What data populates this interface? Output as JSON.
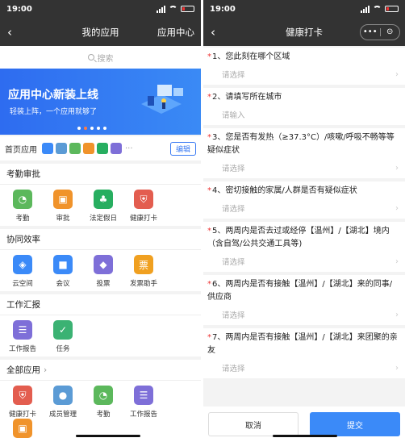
{
  "left": {
    "status_time": "19:00",
    "nav_title": "我的应用",
    "nav_right": "应用中心",
    "search_placeholder": "搜索",
    "banner": {
      "title": "应用中心新装上线",
      "subtitle": "轻装上阵，一个应用就够了"
    },
    "quick_label": "首页应用",
    "quick_more": "···",
    "edit_label": "编辑",
    "sections": [
      {
        "title": "考勤审批",
        "apps": [
          {
            "label": "考勤",
            "icon": "clock-icon",
            "color": "#5cb85c"
          },
          {
            "label": "审批",
            "icon": "stamp-icon",
            "color": "#f0932b"
          },
          {
            "label": "法定假日",
            "icon": "palm-tree-icon",
            "color": "#27ae60"
          },
          {
            "label": "健康打卡",
            "icon": "shield-icon",
            "color": "#e35d4f"
          }
        ]
      },
      {
        "title": "协同效率",
        "apps": [
          {
            "label": "云空间",
            "icon": "cube-icon",
            "color": "#3b8af8"
          },
          {
            "label": "会议",
            "icon": "video-icon",
            "color": "#3b8af8"
          },
          {
            "label": "投票",
            "icon": "vote-icon",
            "color": "#7e6fd8"
          },
          {
            "label": "发票助手",
            "icon": "invoice-icon",
            "color": "#f0a020"
          }
        ]
      },
      {
        "title": "工作汇报",
        "apps": [
          {
            "label": "工作报告",
            "icon": "report-icon",
            "color": "#7e6fd8"
          },
          {
            "label": "任务",
            "icon": "task-check-icon",
            "color": "#3bb273"
          }
        ]
      },
      {
        "title": "全部应用",
        "has_arrow": true,
        "apps": [
          {
            "label": "健康打卡",
            "icon": "shield-icon",
            "color": "#e35d4f"
          },
          {
            "label": "成员管理",
            "icon": "member-icon",
            "color": "#5b9bd5"
          },
          {
            "label": "考勤",
            "icon": "clock-icon",
            "color": "#5cb85c"
          },
          {
            "label": "工作报告",
            "icon": "report-icon",
            "color": "#7e6fd8"
          },
          {
            "label": "审批",
            "icon": "stamp-icon",
            "color": "#f0932b"
          }
        ]
      }
    ],
    "quick_icon_colors": [
      "#3b8af8",
      "#5b9bd5",
      "#5cb85c",
      "#f0932b",
      "#27ae60",
      "#7e6fd8"
    ]
  },
  "right": {
    "status_time": "19:00",
    "nav_title": "健康打卡",
    "capsule_more": "•••",
    "questions": [
      {
        "number": "1、",
        "title": "您此刻在哪个区域",
        "answer": "请选择",
        "has_chevron": true
      },
      {
        "number": "2、",
        "title": "请填写所在城市",
        "answer": "请输入",
        "has_chevron": false
      },
      {
        "number": "3、",
        "title": "您是否有发热（≥37.3°C）/咳嗽/呼吸不畅等等疑似症状",
        "answer": "请选择",
        "has_chevron": true
      },
      {
        "number": "4、",
        "title": "密切接触的家属/人群是否有疑似症状",
        "answer": "请选择",
        "has_chevron": true
      },
      {
        "number": "5、",
        "title": "两周内是否去过或经停【温州】/【湖北】境内（含自驾/公共交通工具等)",
        "answer": "请选择",
        "has_chevron": true
      },
      {
        "number": "6、",
        "title": "两周内是否有接触【温州】/【湖北】来的同事/供应商",
        "answer": "请选择",
        "has_chevron": true
      },
      {
        "number": "7、",
        "title": "两周内是否有接触【温州】/【湖北】来团聚的亲友",
        "answer": "请选择",
        "has_chevron": true
      }
    ],
    "cancel_label": "取消",
    "submit_label": "提交"
  }
}
